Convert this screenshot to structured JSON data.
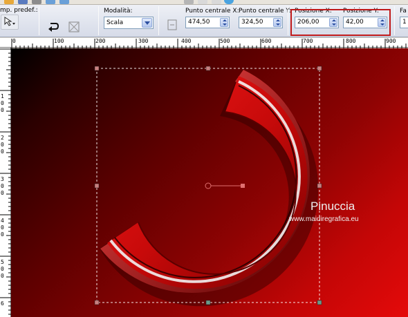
{
  "toolbar": {
    "preset_label": "mp. predef.:",
    "mode_label": "Modalità:",
    "mode_value": "Scala",
    "center_x_label": "Punto centrale X:",
    "center_x_value": "474,50",
    "center_y_label": "Punto centrale Y:",
    "center_y_value": "324,50",
    "pos_x_label": "Posizione X:",
    "pos_x_value": "206,00",
    "pos_y_label": "Posizione Y:",
    "pos_y_value": "42,00",
    "extra_label": "Fa",
    "extra_value": "1"
  },
  "ruler": {
    "top_labels": [
      "0",
      "100",
      "200",
      "300",
      "400",
      "500",
      "600",
      "700",
      "800",
      "900"
    ],
    "left_digits": [
      "1",
      "0",
      "0",
      "2",
      "0",
      "0",
      "3",
      "0",
      "0",
      "4",
      "0",
      "0",
      "5",
      "0",
      "0",
      "6"
    ]
  },
  "canvas": {
    "watermark_name": "Pinuccia",
    "watermark_site": "www.maidiregrafica.eu"
  },
  "colors": {
    "highlight_border": "#c01a1a",
    "canvas_dark": "#000000",
    "canvas_bright": "#e50a0a"
  }
}
